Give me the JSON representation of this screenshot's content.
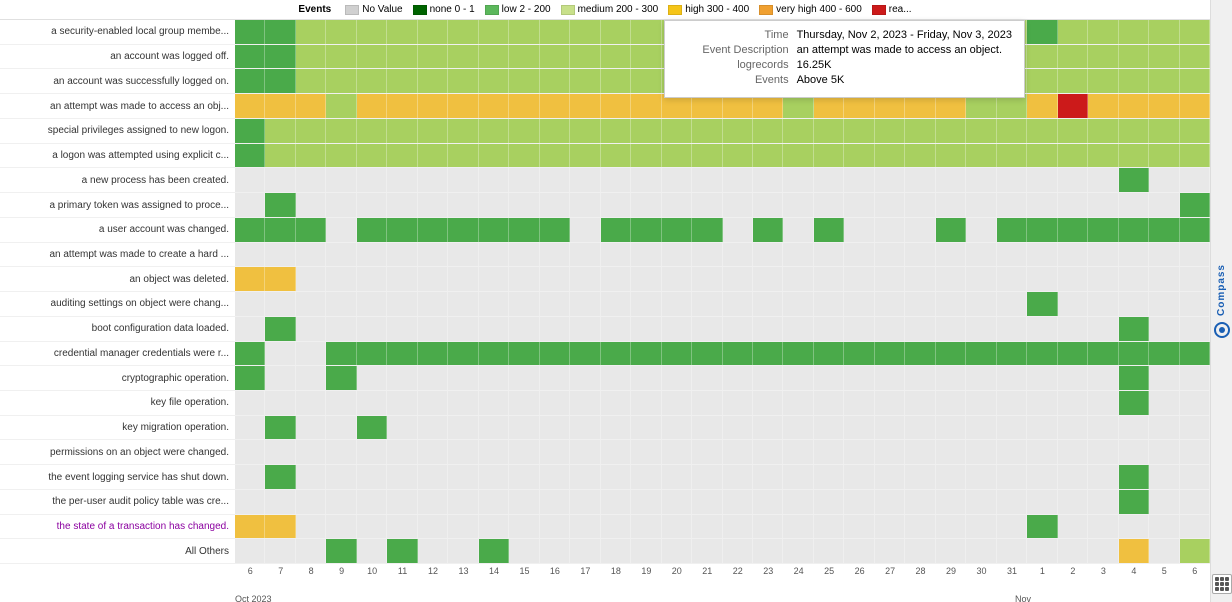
{
  "legend": {
    "title": "Events",
    "items": [
      {
        "label": "No Value",
        "color": "#d0d0d0"
      },
      {
        "label": "none 0 - 1",
        "color": "#006400"
      },
      {
        "label": "low 2 - 200",
        "color": "#5cb85c"
      },
      {
        "label": "medium 200 - 300",
        "color": "#c8e08a"
      },
      {
        "label": "high 300 - 400",
        "color": "#f5c518"
      },
      {
        "label": "very high 400 - 600",
        "color": "#f0a030"
      },
      {
        "label": "rea...",
        "color": "#cc0000"
      }
    ]
  },
  "tooltip": {
    "time_label": "Time",
    "time_value": "Thursday, Nov 2, 2023 - Friday, Nov 3, 2023",
    "event_desc_label": "Event Description",
    "event_desc_value": "an attempt was made to access an object.",
    "logrecords_label": "logrecords",
    "logrecords_value": "16.25K",
    "events_label": "Events",
    "events_value": "Above 5K"
  },
  "rows": [
    {
      "label": "a security-enabled local group membe...",
      "purple": false
    },
    {
      "label": "an account was logged off.",
      "purple": false
    },
    {
      "label": "an account was successfully logged on.",
      "purple": false
    },
    {
      "label": "an attempt was made to access an obj...",
      "purple": false
    },
    {
      "label": "special privileges assigned to new logon.",
      "purple": false
    },
    {
      "label": "a logon was attempted using explicit c...",
      "purple": false
    },
    {
      "label": "a new process has been created.",
      "purple": false
    },
    {
      "label": "a primary token was assigned to proce...",
      "purple": false
    },
    {
      "label": "a user account was changed.",
      "purple": false
    },
    {
      "label": "an attempt was made to create a hard ...",
      "purple": false
    },
    {
      "label": "an object was deleted.",
      "purple": false
    },
    {
      "label": "auditing settings on object were chang...",
      "purple": false
    },
    {
      "label": "boot configuration data loaded.",
      "purple": false
    },
    {
      "label": "credential manager credentials were r...",
      "purple": false
    },
    {
      "label": "cryptographic operation.",
      "purple": false
    },
    {
      "label": "key file operation.",
      "purple": false
    },
    {
      "label": "key migration operation.",
      "purple": false
    },
    {
      "label": "permissions on an object were changed.",
      "purple": false
    },
    {
      "label": "the event logging service has shut down.",
      "purple": false
    },
    {
      "label": "the per-user audit policy table was cre...",
      "purple": false
    },
    {
      "label": "the state of a transaction has changed.",
      "purple": true
    },
    {
      "label": "All Others",
      "purple": false
    }
  ],
  "x_ticks": [
    "6",
    "7",
    "8",
    "9",
    "10",
    "11",
    "12",
    "13",
    "14",
    "15",
    "16",
    "17",
    "18",
    "19",
    "20",
    "21",
    "22",
    "23",
    "24",
    "25",
    "26",
    "27",
    "28",
    "29",
    "30",
    "31",
    "1",
    "2",
    "3",
    "4",
    "5",
    "6"
  ],
  "month_labels": [
    {
      "label": "Oct 2023",
      "offset_pct": 0
    },
    {
      "label": "Nov",
      "offset_pct": 80
    }
  ],
  "compass_label": "Compass",
  "heatmap_data": [
    [
      2,
      2,
      3,
      3,
      3,
      3,
      3,
      3,
      3,
      3,
      3,
      3,
      3,
      3,
      3,
      3,
      3,
      3,
      3,
      3,
      3,
      3,
      3,
      3,
      3,
      3,
      2,
      3,
      3,
      3,
      3,
      3
    ],
    [
      2,
      2,
      3,
      3,
      3,
      3,
      3,
      3,
      3,
      3,
      3,
      3,
      3,
      3,
      3,
      3,
      3,
      3,
      3,
      3,
      3,
      3,
      3,
      3,
      3,
      3,
      3,
      3,
      3,
      3,
      3,
      3
    ],
    [
      2,
      2,
      3,
      3,
      3,
      3,
      3,
      3,
      3,
      3,
      3,
      3,
      3,
      3,
      3,
      3,
      3,
      3,
      3,
      3,
      3,
      3,
      3,
      3,
      3,
      3,
      3,
      3,
      3,
      3,
      3,
      3
    ],
    [
      4,
      4,
      4,
      3,
      4,
      4,
      4,
      4,
      4,
      4,
      4,
      4,
      4,
      4,
      4,
      4,
      4,
      4,
      3,
      4,
      4,
      4,
      4,
      4,
      3,
      3,
      4,
      6,
      4,
      4,
      4,
      4
    ],
    [
      2,
      3,
      3,
      3,
      3,
      3,
      3,
      3,
      3,
      3,
      3,
      3,
      3,
      3,
      3,
      3,
      3,
      3,
      3,
      3,
      3,
      3,
      3,
      3,
      3,
      3,
      3,
      3,
      3,
      3,
      3,
      3
    ],
    [
      2,
      3,
      3,
      3,
      3,
      3,
      3,
      3,
      3,
      3,
      3,
      3,
      3,
      3,
      3,
      3,
      3,
      3,
      3,
      3,
      3,
      3,
      3,
      3,
      3,
      3,
      3,
      3,
      3,
      3,
      3,
      3
    ],
    [
      0,
      0,
      0,
      0,
      0,
      0,
      0,
      0,
      0,
      0,
      0,
      0,
      0,
      0,
      0,
      0,
      0,
      0,
      0,
      0,
      0,
      0,
      0,
      0,
      0,
      0,
      0,
      0,
      0,
      2,
      0,
      0
    ],
    [
      0,
      2,
      0,
      0,
      0,
      0,
      0,
      0,
      0,
      0,
      0,
      0,
      0,
      0,
      0,
      0,
      0,
      0,
      0,
      0,
      0,
      0,
      0,
      0,
      0,
      0,
      0,
      0,
      0,
      0,
      0,
      2
    ],
    [
      2,
      2,
      2,
      0,
      2,
      2,
      2,
      2,
      2,
      2,
      2,
      0,
      2,
      2,
      2,
      2,
      0,
      2,
      0,
      2,
      0,
      0,
      0,
      2,
      0,
      2,
      2,
      2,
      2,
      2,
      2,
      2
    ],
    [
      0,
      0,
      0,
      0,
      0,
      0,
      0,
      0,
      0,
      0,
      0,
      0,
      0,
      0,
      0,
      0,
      0,
      0,
      0,
      0,
      0,
      0,
      0,
      0,
      0,
      0,
      0,
      0,
      0,
      0,
      0,
      0
    ],
    [
      4,
      4,
      0,
      0,
      0,
      0,
      0,
      0,
      0,
      0,
      0,
      0,
      0,
      0,
      0,
      0,
      0,
      0,
      0,
      0,
      0,
      0,
      0,
      0,
      0,
      0,
      0,
      0,
      0,
      0,
      0,
      0
    ],
    [
      0,
      0,
      0,
      0,
      0,
      0,
      0,
      0,
      0,
      0,
      0,
      0,
      0,
      0,
      0,
      0,
      0,
      0,
      0,
      0,
      0,
      0,
      0,
      0,
      0,
      0,
      2,
      0,
      0,
      0,
      0,
      0
    ],
    [
      0,
      2,
      0,
      0,
      0,
      0,
      0,
      0,
      0,
      0,
      0,
      0,
      0,
      0,
      0,
      0,
      0,
      0,
      0,
      0,
      0,
      0,
      0,
      0,
      0,
      0,
      0,
      0,
      0,
      2,
      0,
      0
    ],
    [
      2,
      0,
      0,
      2,
      2,
      2,
      2,
      2,
      2,
      2,
      2,
      2,
      2,
      2,
      2,
      2,
      2,
      2,
      2,
      2,
      2,
      2,
      2,
      2,
      2,
      2,
      2,
      2,
      2,
      2,
      2,
      2
    ],
    [
      2,
      0,
      0,
      2,
      0,
      0,
      0,
      0,
      0,
      0,
      0,
      0,
      0,
      0,
      0,
      0,
      0,
      0,
      0,
      0,
      0,
      0,
      0,
      0,
      0,
      0,
      0,
      0,
      0,
      2,
      0,
      0
    ],
    [
      0,
      0,
      0,
      0,
      0,
      0,
      0,
      0,
      0,
      0,
      0,
      0,
      0,
      0,
      0,
      0,
      0,
      0,
      0,
      0,
      0,
      0,
      0,
      0,
      0,
      0,
      0,
      0,
      0,
      2,
      0,
      0
    ],
    [
      0,
      2,
      0,
      0,
      2,
      0,
      0,
      0,
      0,
      0,
      0,
      0,
      0,
      0,
      0,
      0,
      0,
      0,
      0,
      0,
      0,
      0,
      0,
      0,
      0,
      0,
      0,
      0,
      0,
      0,
      0,
      0
    ],
    [
      0,
      0,
      0,
      0,
      0,
      0,
      0,
      0,
      0,
      0,
      0,
      0,
      0,
      0,
      0,
      0,
      0,
      0,
      0,
      0,
      0,
      0,
      0,
      0,
      0,
      0,
      0,
      0,
      0,
      0,
      0,
      0
    ],
    [
      0,
      2,
      0,
      0,
      0,
      0,
      0,
      0,
      0,
      0,
      0,
      0,
      0,
      0,
      0,
      0,
      0,
      0,
      0,
      0,
      0,
      0,
      0,
      0,
      0,
      0,
      0,
      0,
      0,
      2,
      0,
      0
    ],
    [
      0,
      0,
      0,
      0,
      0,
      0,
      0,
      0,
      0,
      0,
      0,
      0,
      0,
      0,
      0,
      0,
      0,
      0,
      0,
      0,
      0,
      0,
      0,
      0,
      0,
      0,
      0,
      0,
      0,
      2,
      0,
      0
    ],
    [
      4,
      4,
      0,
      0,
      0,
      0,
      0,
      0,
      0,
      0,
      0,
      0,
      0,
      0,
      0,
      0,
      0,
      0,
      0,
      0,
      0,
      0,
      0,
      0,
      0,
      0,
      2,
      0,
      0,
      0,
      0,
      0
    ],
    [
      0,
      0,
      0,
      2,
      0,
      2,
      0,
      0,
      2,
      0,
      0,
      0,
      0,
      0,
      0,
      0,
      0,
      0,
      0,
      0,
      0,
      0,
      0,
      0,
      0,
      0,
      0,
      0,
      0,
      4,
      0,
      3
    ]
  ],
  "colors": {
    "none": "#f5f5f5",
    "level0": "#e8e8e8",
    "level1": "#1a7a1a",
    "level2": "#4aaa4a",
    "level3": "#a8d060",
    "level4": "#f0c040",
    "level5": "#e88020",
    "level6": "#cc1a1a"
  }
}
